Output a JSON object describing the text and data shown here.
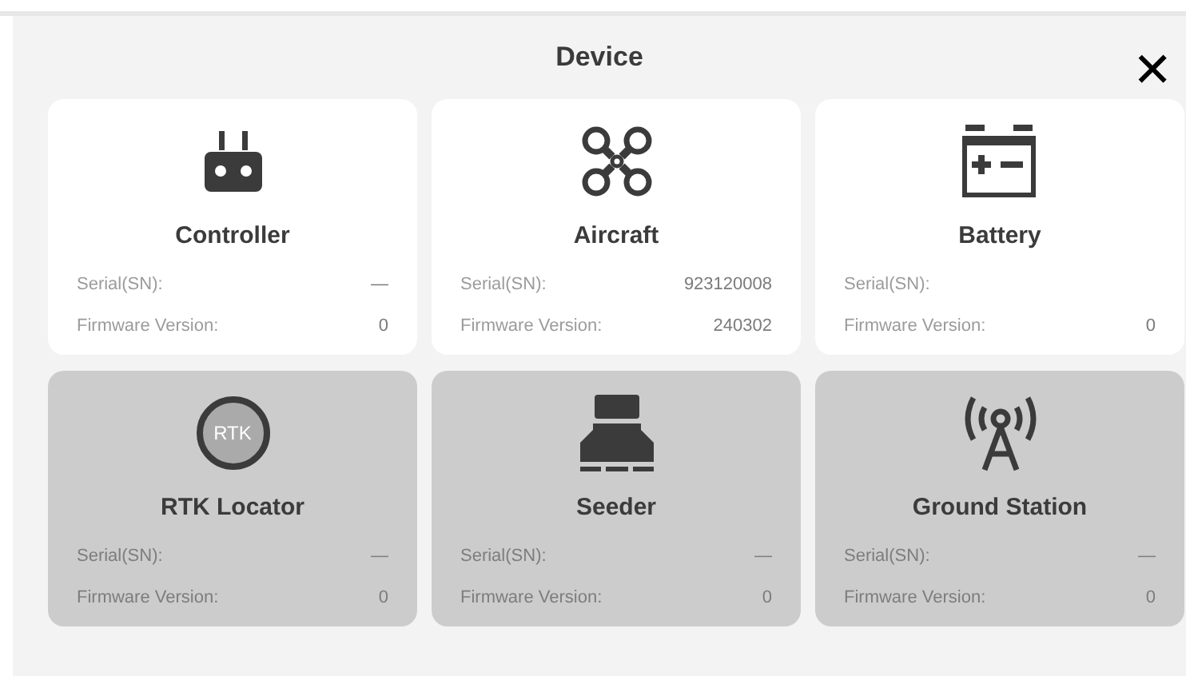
{
  "title": "Device",
  "close": {
    "label": "✕"
  },
  "devices": [
    {
      "kind": "controller",
      "name": "Controller",
      "connected": true,
      "serial_label": "Serial(SN):",
      "serial": "—",
      "firmware_label": "Firmware Version:",
      "firmware": "0"
    },
    {
      "kind": "aircraft",
      "name": "Aircraft",
      "connected": true,
      "serial_label": "Serial(SN):",
      "serial": "923120008",
      "firmware_label": "Firmware Version:",
      "firmware": "240302"
    },
    {
      "kind": "battery",
      "name": "Battery",
      "connected": true,
      "serial_label": "Serial(SN):",
      "firmware_label": "Firmware Version:",
      "firmware": "0"
    },
    {
      "kind": "rtk",
      "icon_text": "RTK",
      "name": "RTK Locator",
      "connected": false,
      "serial_label": "Serial(SN):",
      "serial": "—",
      "firmware_label": "Firmware Version:",
      "firmware": "0"
    },
    {
      "kind": "seeder",
      "name": "Seeder",
      "connected": false,
      "serial_label": "Serial(SN):",
      "serial": "—",
      "firmware_label": "Firmware Version:",
      "firmware": "0"
    },
    {
      "kind": "station",
      "name": "Ground Station",
      "connected": false,
      "serial_label": "Serial(SN):",
      "serial": "—",
      "firmware_label": "Firmware Version:",
      "firmware": "0"
    }
  ]
}
